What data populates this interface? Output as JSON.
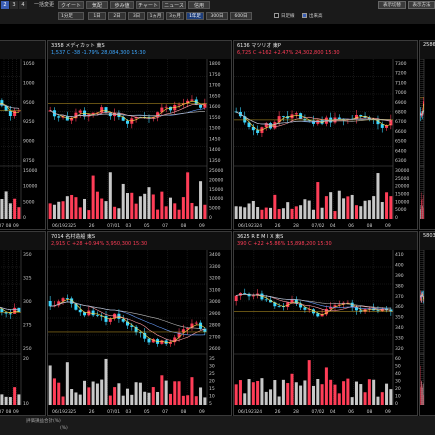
{
  "toolbar": {
    "tabs": [
      "2",
      "3",
      "4"
    ],
    "active_tab": 0,
    "row1_buttons": [
      "クイート",
      "気配",
      "歩み値",
      "チャート",
      "ニュース",
      "信用"
    ],
    "title_label": "一括変更",
    "right_buttons": [
      "表示切替",
      "表示方法"
    ],
    "period_dropdown": "1分足",
    "periods": [
      "1日",
      "2日",
      "3日",
      "1ヵ月",
      "3ヵ月",
      "1年足",
      "300日",
      "600日"
    ],
    "active_period": 5,
    "checkboxes": [
      {
        "label": "日足線",
        "checked": false
      },
      {
        "label": "出来高",
        "checked": true
      }
    ]
  },
  "panels": [
    {
      "id": "p1",
      "name": "",
      "quote": "",
      "trend": "up",
      "price_labels": [
        "1050",
        "1000",
        "9500",
        "9250",
        "9000",
        "8750"
      ],
      "vol_labels": [
        "15000",
        "10000",
        "5000",
        "0"
      ],
      "x_labels": [
        "06",
        "07",
        "08",
        "09"
      ]
    },
    {
      "id": "p2",
      "name": "3358 メディカット 東S",
      "quote": "1,537 C   -38  -1.79%   28,084,300  15:30",
      "trend": "down",
      "price_labels": [
        "1800",
        "1750",
        "1700",
        "1650",
        "1600",
        "1550",
        "1500",
        "1450",
        "1400",
        "1350"
      ],
      "vol_labels": [
        "25000",
        "20000",
        "15000",
        "10000",
        "5000",
        "0"
      ],
      "x_labels": [
        "06/1923",
        "25",
        "26",
        "07/01",
        "03",
        "05",
        "07",
        "08",
        "09"
      ]
    },
    {
      "id": "p3",
      "name": "6136 マツリオ 東P",
      "quote": "6,725 C   +162  +2.47%   24,302,800  15:30",
      "trend": "up",
      "price_labels": [
        "7300",
        "7200",
        "7100",
        "7000",
        "6900",
        "6800",
        "6700",
        "6600",
        "6500",
        "6400",
        "6300"
      ],
      "vol_labels": [
        "30000",
        "25000",
        "20000",
        "15000",
        "10000",
        "5000",
        "0"
      ],
      "x_labels": [
        "06/1923",
        "24",
        "26",
        "28",
        "07/02",
        "04",
        "06",
        "08",
        "09"
      ]
    },
    {
      "id": "p4",
      "name": "2586",
      "quote": "",
      "trend": "up",
      "price_labels": [],
      "vol_labels": [],
      "x_labels": []
    },
    {
      "id": "p5",
      "name": "",
      "quote": "",
      "trend": "up",
      "price_labels": [
        "350",
        "325",
        "300",
        "275",
        "250"
      ],
      "vol_labels": [
        "20",
        "10"
      ],
      "x_labels": [
        "06",
        "07",
        "08",
        "09"
      ]
    },
    {
      "id": "p6",
      "name": "7014 名村造船 東S",
      "quote": "2,915 C   +28  +0.94%   3,950,300  15:30",
      "trend": "up",
      "price_labels": [
        "3400",
        "3300",
        "3200",
        "3100",
        "3000",
        "2900",
        "2800",
        "2700",
        "2600"
      ],
      "vol_labels": [
        "35",
        "30",
        "25",
        "20",
        "15",
        "10",
        "5"
      ],
      "x_labels": [
        "06/1923",
        "25",
        "26",
        "07/01",
        "03",
        "05",
        "07",
        "08",
        "09"
      ]
    },
    {
      "id": "p7",
      "name": "3625 R E M I X 東S",
      "quote": "390 C   +22  +5.86%   15,898,200  15:30",
      "trend": "up",
      "price_labels": [
        "410",
        "400",
        "390",
        "380",
        "370",
        "360",
        "350",
        "340",
        "330",
        "320"
      ],
      "vol_labels": [
        "60",
        "50",
        "40",
        "30",
        "20",
        "10",
        "0"
      ],
      "x_labels": [
        "06/1923",
        "24",
        "26",
        "28",
        "07/02",
        "04",
        "06",
        "08",
        "09"
      ]
    },
    {
      "id": "p8",
      "name": "5803",
      "quote": "",
      "trend": "up",
      "price_labels": [],
      "vol_labels": [],
      "x_labels": []
    }
  ],
  "statusbar": {
    "left": "評価損益合計(%)",
    "right": "(%)"
  },
  "colors": {
    "up": "#ff3d57",
    "down": "#3ea8ff",
    "ma_short": "#ffe14d",
    "ma_mid": "#ff9aa2",
    "ma_long": "#6aa0ff",
    "ma_xlong": "#bbbbbb",
    "grid": "#2a2a2a"
  }
}
